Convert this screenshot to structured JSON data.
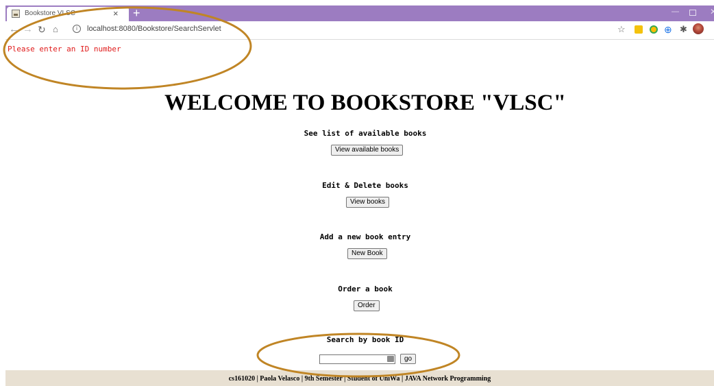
{
  "browser": {
    "tab_title": "Bookstore VLSC",
    "url": "localhost:8080/Bookstore/SearchServlet",
    "theme_color": "#9c7cc1",
    "icons": {
      "favicon": "bookstore-favicon-icon",
      "tab_close": "close-icon",
      "new_tab": "plus-icon",
      "back": "arrow-left-icon",
      "forward": "arrow-right-icon",
      "reload": "reload-icon",
      "home": "home-icon",
      "site_info": "info-icon",
      "bookmark": "star-icon",
      "extensions": [
        "extension-yellow-icon",
        "extension-green-icon",
        "extension-blue-icon",
        "puzzle-icon"
      ],
      "profile": "avatar-icon",
      "menu": "kebab-menu-icon"
    }
  },
  "page": {
    "error_message": "Please enter an ID number",
    "error_color": "#e01b1b",
    "title": "WELCOME TO BOOKSTORE \"VLSC\"",
    "sections": {
      "list": {
        "label": "See list of available books",
        "button": "View available books"
      },
      "edit": {
        "label": "Edit & Delete books",
        "button": "View books"
      },
      "add": {
        "label": "Add a new book entry",
        "button": "New Book"
      },
      "order": {
        "label": "Order a book",
        "button": "Order"
      },
      "search": {
        "label": "Search by book ID",
        "input_value": "",
        "button": "go"
      }
    },
    "footer": "cs161020 | Paola Velasco | 9th Semester | Student of UniWa | JAVA Network Programming",
    "footer_color": "#e8e0d2"
  },
  "annotations": {
    "color": "#c08525",
    "ellipses": [
      "highlight-error-area",
      "highlight-search-area"
    ]
  }
}
